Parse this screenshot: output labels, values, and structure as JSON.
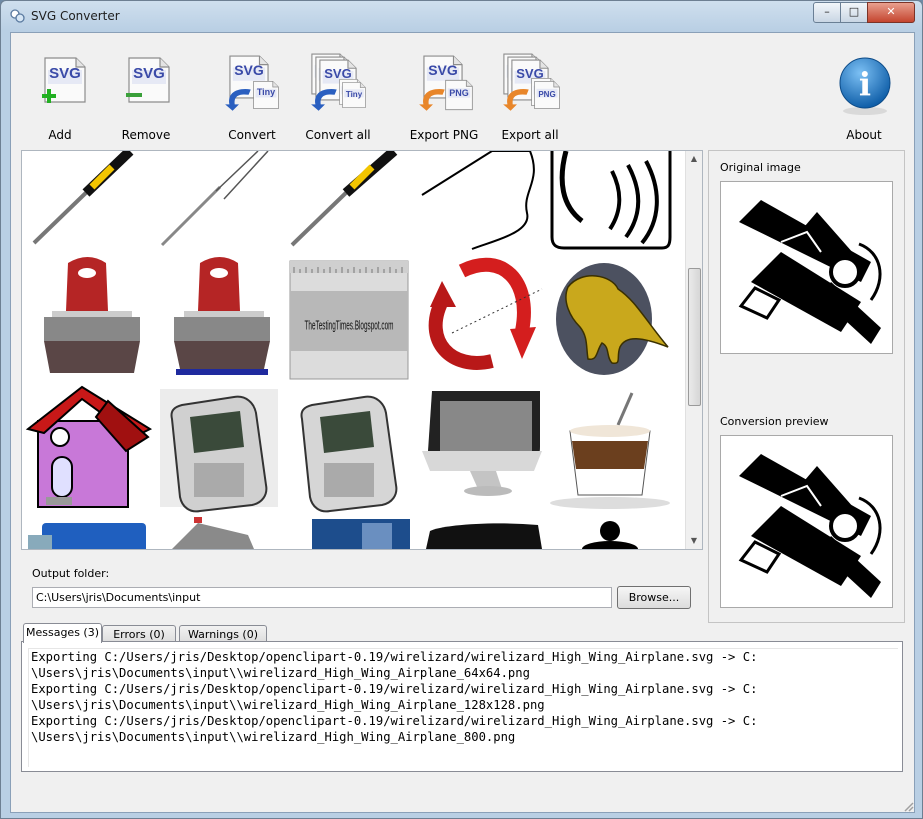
{
  "window": {
    "title": "SVG Converter",
    "controls": {
      "minimize": "–",
      "maximize": "□",
      "close": "✕"
    }
  },
  "toolbar": [
    {
      "id": "add",
      "label": "Add",
      "icon": "svg-add-icon"
    },
    {
      "id": "remove",
      "label": "Remove",
      "icon": "svg-remove-icon"
    },
    {
      "id": "convert",
      "label": "Convert",
      "icon": "svg-to-tiny-icon"
    },
    {
      "id": "convert-all",
      "label": "Convert all",
      "icon": "svg-to-tiny-multi-icon"
    },
    {
      "id": "export-png",
      "label": "Export PNG",
      "icon": "svg-to-png-icon"
    },
    {
      "id": "export-all",
      "label": "Export all",
      "icon": "svg-to-png-multi-icon"
    },
    {
      "id": "about",
      "label": "About",
      "icon": "info-icon"
    }
  ],
  "icon_text": {
    "svg": "SVG",
    "tiny": "Tiny",
    "png": "PNG",
    "info": "i"
  },
  "gallery": {
    "thumbnails": [
      "screwdriver-yellow",
      "screwdriver-outline",
      "screwdriver-yellow-2",
      "cloud-outline",
      "ear-sound-tile",
      "red-rubber-stamp",
      "red-rubber-stamp-blue",
      "ruler-banner",
      "red-refresh-arrows",
      "dinosaur-badge",
      "purple-house",
      "mobile-phone-shaded",
      "mobile-phone",
      "imac-monitor",
      "latte-glass",
      "blue-truck",
      "grey-tent",
      "city-skyline",
      "black-vehicle",
      "person-silhouette"
    ],
    "ruler_text": "TheTestingTimes.Blogspot.com"
  },
  "side": {
    "original_caption": "Original image",
    "preview_caption": "Conversion preview"
  },
  "output": {
    "label": "Output folder:",
    "value": "C:\\Users\\jris\\Documents\\input",
    "browse_label": "Browse..."
  },
  "tabs": [
    {
      "label": "Messages (3)",
      "active": true
    },
    {
      "label": "Errors (0)",
      "active": false
    },
    {
      "label": "Warnings (0)",
      "active": false
    }
  ],
  "messages": [
    "Exporting C:/Users/jris/Desktop/openclipart-0.19/wirelizard/wirelizard_High_Wing_Airplane.svg -> C:",
    "\\Users\\jris\\Documents\\input\\\\wirelizard_High_Wing_Airplane_64x64.png",
    "Exporting C:/Users/jris/Desktop/openclipart-0.19/wirelizard/wirelizard_High_Wing_Airplane.svg -> C:",
    "\\Users\\jris\\Documents\\input\\\\wirelizard_High_Wing_Airplane_128x128.png",
    "Exporting C:/Users/jris/Desktop/openclipart-0.19/wirelizard/wirelizard_High_Wing_Airplane.svg -> C:",
    "\\Users\\jris\\Documents\\input\\\\wirelizard_High_Wing_Airplane_800.png"
  ],
  "colors": {
    "svg_blue": "#3a4aa8",
    "tiny_arrow": "#2a5fc0",
    "png_arrow": "#e8862a",
    "add_green": "#22b022",
    "remove_green": "#3aa03a",
    "info_blue": "#1b74c5"
  }
}
